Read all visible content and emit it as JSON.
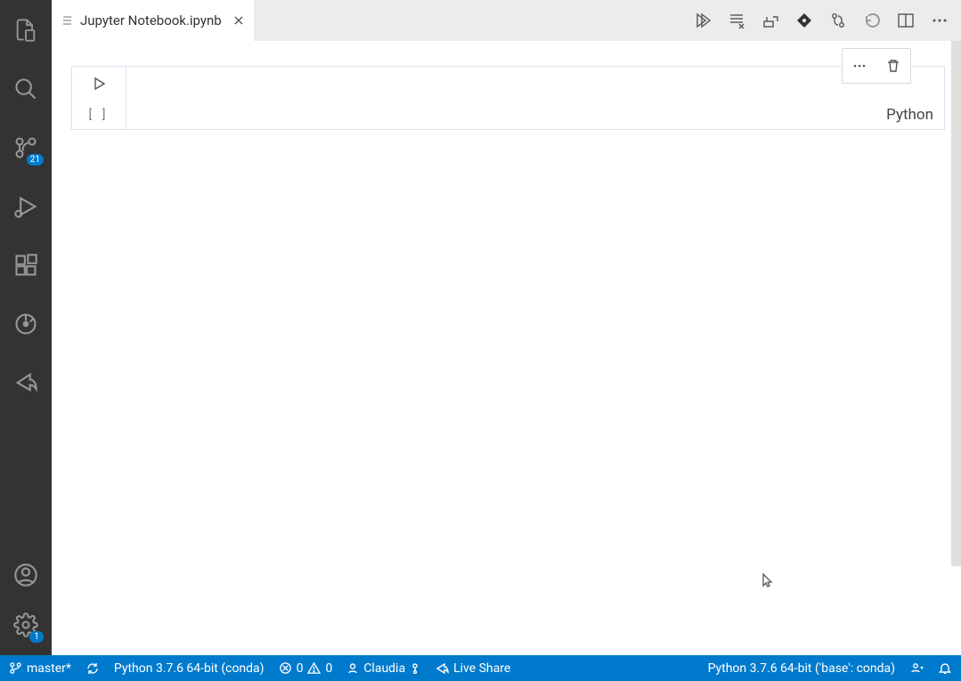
{
  "tab": {
    "title": "Jupyter Notebook.ipynb"
  },
  "cell": {
    "exec_label": "[ ]",
    "language": "Python"
  },
  "activity": {
    "source_control_badge": "21",
    "settings_badge": "1"
  },
  "status": {
    "branch": "master*",
    "python_local": "Python 3.7.6 64-bit (conda)",
    "errors": "0",
    "warnings": "0",
    "user": "Claudia",
    "live_share": "Live Share",
    "python_kernel": "Python 3.7.6 64-bit ('base': conda)"
  }
}
